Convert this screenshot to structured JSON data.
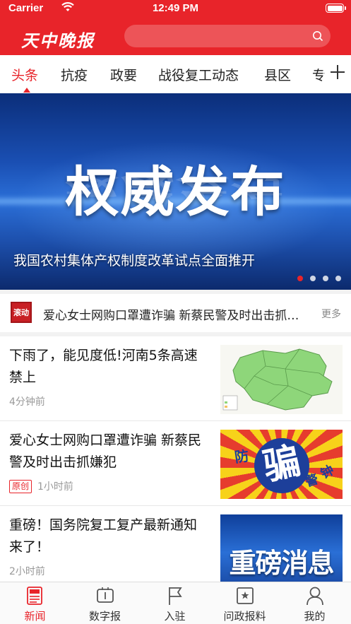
{
  "status_bar": {
    "carrier": "Carrier",
    "time": "12:49 PM"
  },
  "header": {
    "logo": "天中晚报",
    "search_placeholder": ""
  },
  "tabs": [
    "头条",
    "抗疫",
    "政要",
    "战役复工动态",
    "县区",
    "专"
  ],
  "active_tab": "头条",
  "banner": {
    "headline": "权威发布",
    "caption": "我国农村集体产权制度改革试点全面推开",
    "slide_count": 4,
    "active_slide": 1
  },
  "ticker": {
    "badge": "滚动",
    "text": "爱心女士网购口罩遭诈骗 新蔡民警及时出击抓…",
    "more": "更多"
  },
  "news": [
    {
      "title": "下雨了，能见度低!河南5条高速禁上",
      "time": "4分钟前",
      "tag": "",
      "thumb": "map"
    },
    {
      "title": "爱心女士网购口罩遭诈骗 新蔡民警及时出击抓嫌犯",
      "time": "1小时前",
      "tag": "原创",
      "thumb": "fraud",
      "thumb_text": {
        "left": "防",
        "center": "骗",
        "right1": "警",
        "right2": "钟"
      }
    },
    {
      "title": "重磅！国务院复工复产最新通知来了！",
      "time": "2小时前",
      "tag": "",
      "thumb": "heavy",
      "thumb_text": "重磅消息"
    }
  ],
  "tabbar": [
    {
      "label": "新闻",
      "icon": "news-icon",
      "active": true
    },
    {
      "label": "数字报",
      "icon": "digital-paper-icon",
      "active": false
    },
    {
      "label": "入驻",
      "icon": "flag-icon",
      "active": false
    },
    {
      "label": "问政报料",
      "icon": "report-icon",
      "active": false
    },
    {
      "label": "我的",
      "icon": "profile-icon",
      "active": false
    }
  ],
  "colors": {
    "brand": "#e8242a",
    "text": "#222222",
    "muted": "#999999"
  }
}
